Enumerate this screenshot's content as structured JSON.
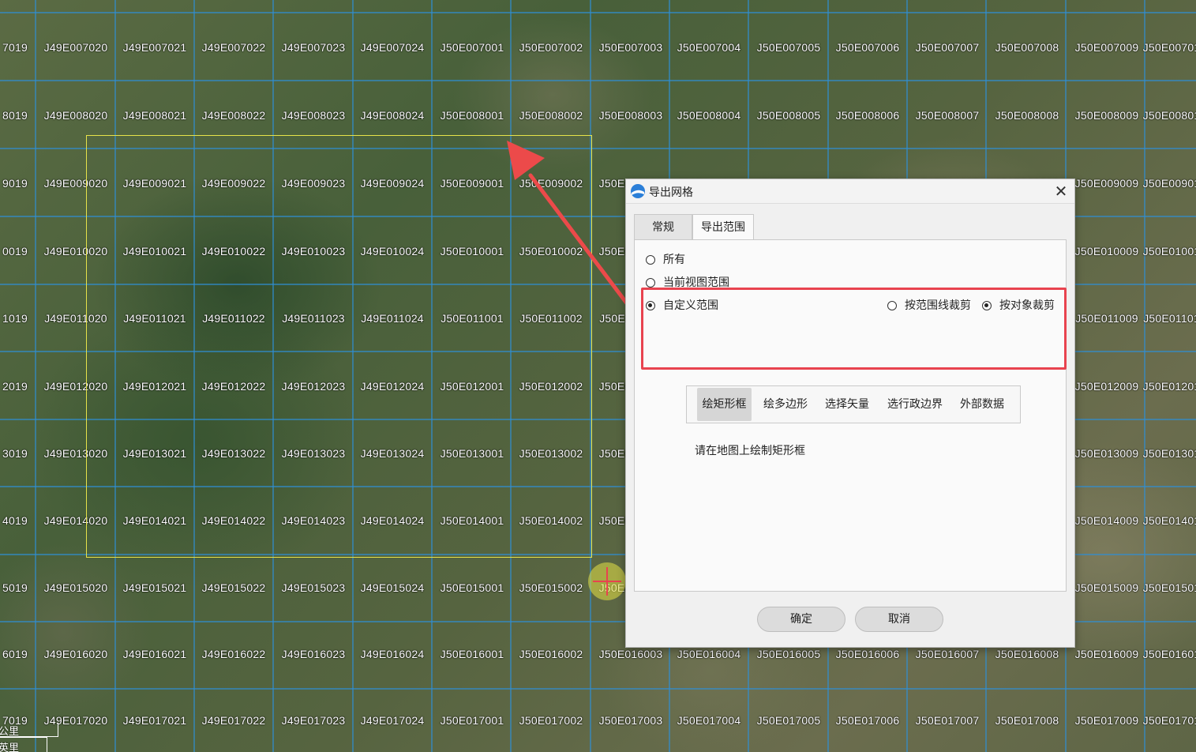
{
  "map": {
    "rows": [
      {
        "left": "J49E0070",
        "right": "J50E0070",
        "left_start": "7019"
      },
      {
        "left": "J49E0080",
        "right": "J50E0080",
        "left_start": "8019"
      },
      {
        "left": "J49E0090",
        "right": "J50E0090",
        "left_start": "9019"
      },
      {
        "left": "J49E0100",
        "right": "J50E0100",
        "left_start": "0019"
      },
      {
        "left": "J49E0110",
        "right": "J50E0110",
        "left_start": "1019"
      },
      {
        "left": "J49E0120",
        "right": "J50E0120",
        "left_start": "2019"
      },
      {
        "left": "J49E0130",
        "right": "J50E0130",
        "left_start": "3019"
      },
      {
        "left": "J49E0140",
        "right": "J50E0140",
        "left_start": "4019"
      },
      {
        "left": "J49E0150",
        "right": "J50E0150",
        "left_start": "5019"
      },
      {
        "left": "J49E0160",
        "right": "J50E0160",
        "left_start": "6019"
      },
      {
        "left": "J49E0170",
        "right": "J50E0170",
        "left_start": "7019"
      }
    ],
    "scale": {
      "km_label": "公里",
      "mi_label": "英里"
    }
  },
  "dialog": {
    "title": "导出网格",
    "close_glyph": "✕",
    "tabs": {
      "general": "常规",
      "export_range": "导出范围"
    },
    "options": {
      "all": "所有",
      "current_view": "当前视图范围",
      "custom": "自定义范围",
      "clip_by_boundary": "按范围线裁剪",
      "clip_by_object": "按对象裁剪"
    },
    "tools": {
      "draw_rect": "绘矩形框",
      "draw_polygon": "绘多边形",
      "select_vector": "选择矢量",
      "select_admin": "选行政边界",
      "external_data": "外部数据"
    },
    "hint": "请在地图上绘制矩形框",
    "buttons": {
      "ok": "确定",
      "cancel": "取消"
    }
  },
  "colors": {
    "grid_line": "#2f8fd6",
    "selection": "#e7e34a",
    "highlight": "#e8434f",
    "arrow": "#ec4a4a"
  }
}
